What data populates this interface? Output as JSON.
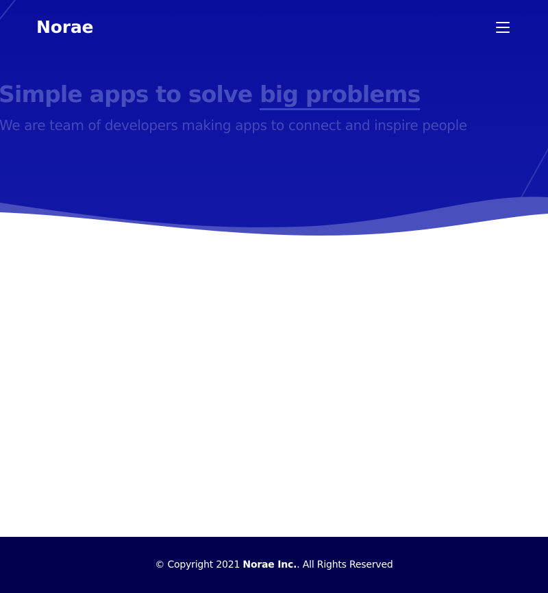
{
  "header": {
    "logo_text": "Norae",
    "menu_icon": "hamburger-menu-icon"
  },
  "hero": {
    "title_plain": "Simple apps to solve ",
    "title_highlight": "big problems",
    "subtitle": "We are team of developers making apps to connect and inspire people",
    "colors": {
      "background": "#0a0f9e",
      "wave_light": "#4a50c0",
      "title_underline": "#4a6ae6"
    }
  },
  "footer": {
    "copyright_prefix": "© Copyright 2021 ",
    "company": "Norae Inc.",
    "suffix": ". All Rights Reserved",
    "background": "#00004e"
  }
}
